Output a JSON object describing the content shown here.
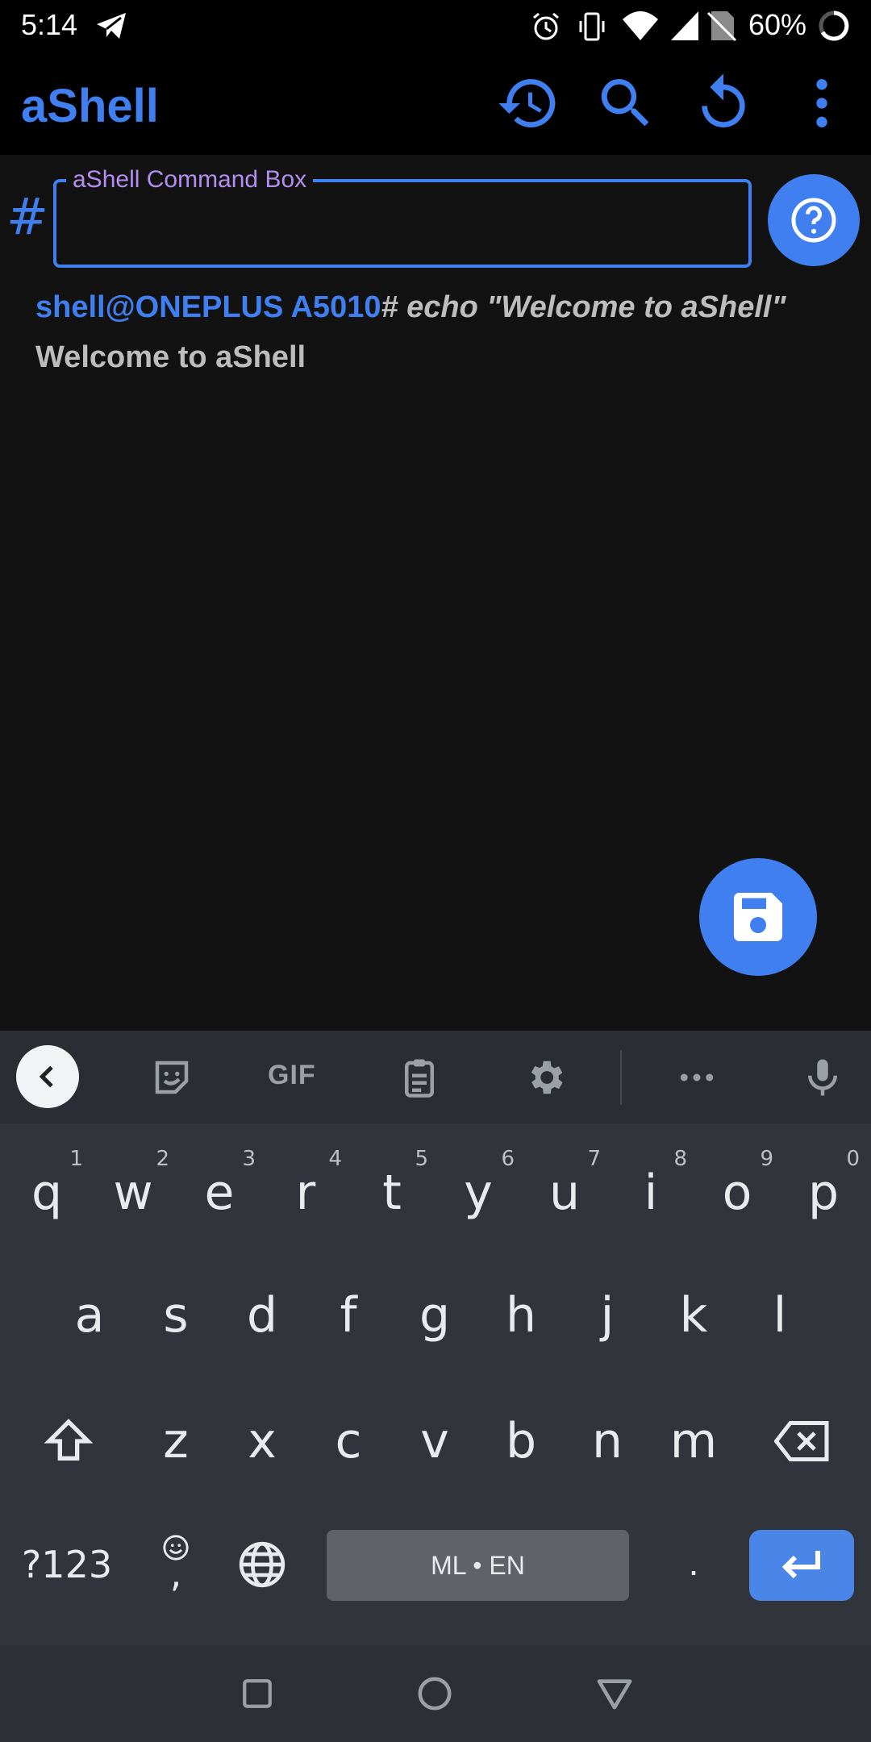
{
  "status_bar": {
    "time": "5:14",
    "battery": "60%",
    "icons": [
      "telegram-icon",
      "alarm-icon",
      "vibrate-icon",
      "wifi-icon",
      "signal-icon",
      "no-sim-icon",
      "battery-icon"
    ]
  },
  "app_bar": {
    "title": "aShell",
    "actions": [
      "history-icon",
      "search-icon",
      "refresh-icon",
      "more-vert-icon"
    ]
  },
  "command": {
    "prefix": "#",
    "label": "aShell Command Box",
    "value": ""
  },
  "output": {
    "prompt": "shell@ONEPLUS A5010",
    "command": "# echo \"Welcome to aShell\"",
    "result": "Welcome to aShell"
  },
  "fabs": [
    "help-icon",
    "save-icon"
  ],
  "keyboard": {
    "toolbar": {
      "gif_label": "GIF",
      "items": [
        "chevron-left-icon",
        "sticker-icon",
        "gif",
        "clipboard-icon",
        "settings-icon",
        "more-horiz-icon",
        "mic-icon"
      ]
    },
    "row1": [
      {
        "char": "q",
        "hint": "1"
      },
      {
        "char": "w",
        "hint": "2"
      },
      {
        "char": "e",
        "hint": "3"
      },
      {
        "char": "r",
        "hint": "4"
      },
      {
        "char": "t",
        "hint": "5"
      },
      {
        "char": "y",
        "hint": "6"
      },
      {
        "char": "u",
        "hint": "7"
      },
      {
        "char": "i",
        "hint": "8"
      },
      {
        "char": "o",
        "hint": "9"
      },
      {
        "char": "p",
        "hint": "0"
      }
    ],
    "row2": [
      "a",
      "s",
      "d",
      "f",
      "g",
      "h",
      "j",
      "k",
      "l"
    ],
    "row3": [
      "z",
      "x",
      "c",
      "v",
      "b",
      "n",
      "m"
    ],
    "symbols_label": "?123",
    "comma": ",",
    "space_label": "ML • EN",
    "period": ".",
    "icons": [
      "shift-icon",
      "backspace-icon",
      "emoji-icon",
      "globe-icon",
      "enter-icon"
    ]
  },
  "nav_bar": [
    "recents-icon",
    "home-icon",
    "back-icon"
  ],
  "colors": {
    "accent": "#3f7ff0",
    "label": "#b38df0",
    "background": "#121212",
    "keyboard": "#31353b"
  }
}
